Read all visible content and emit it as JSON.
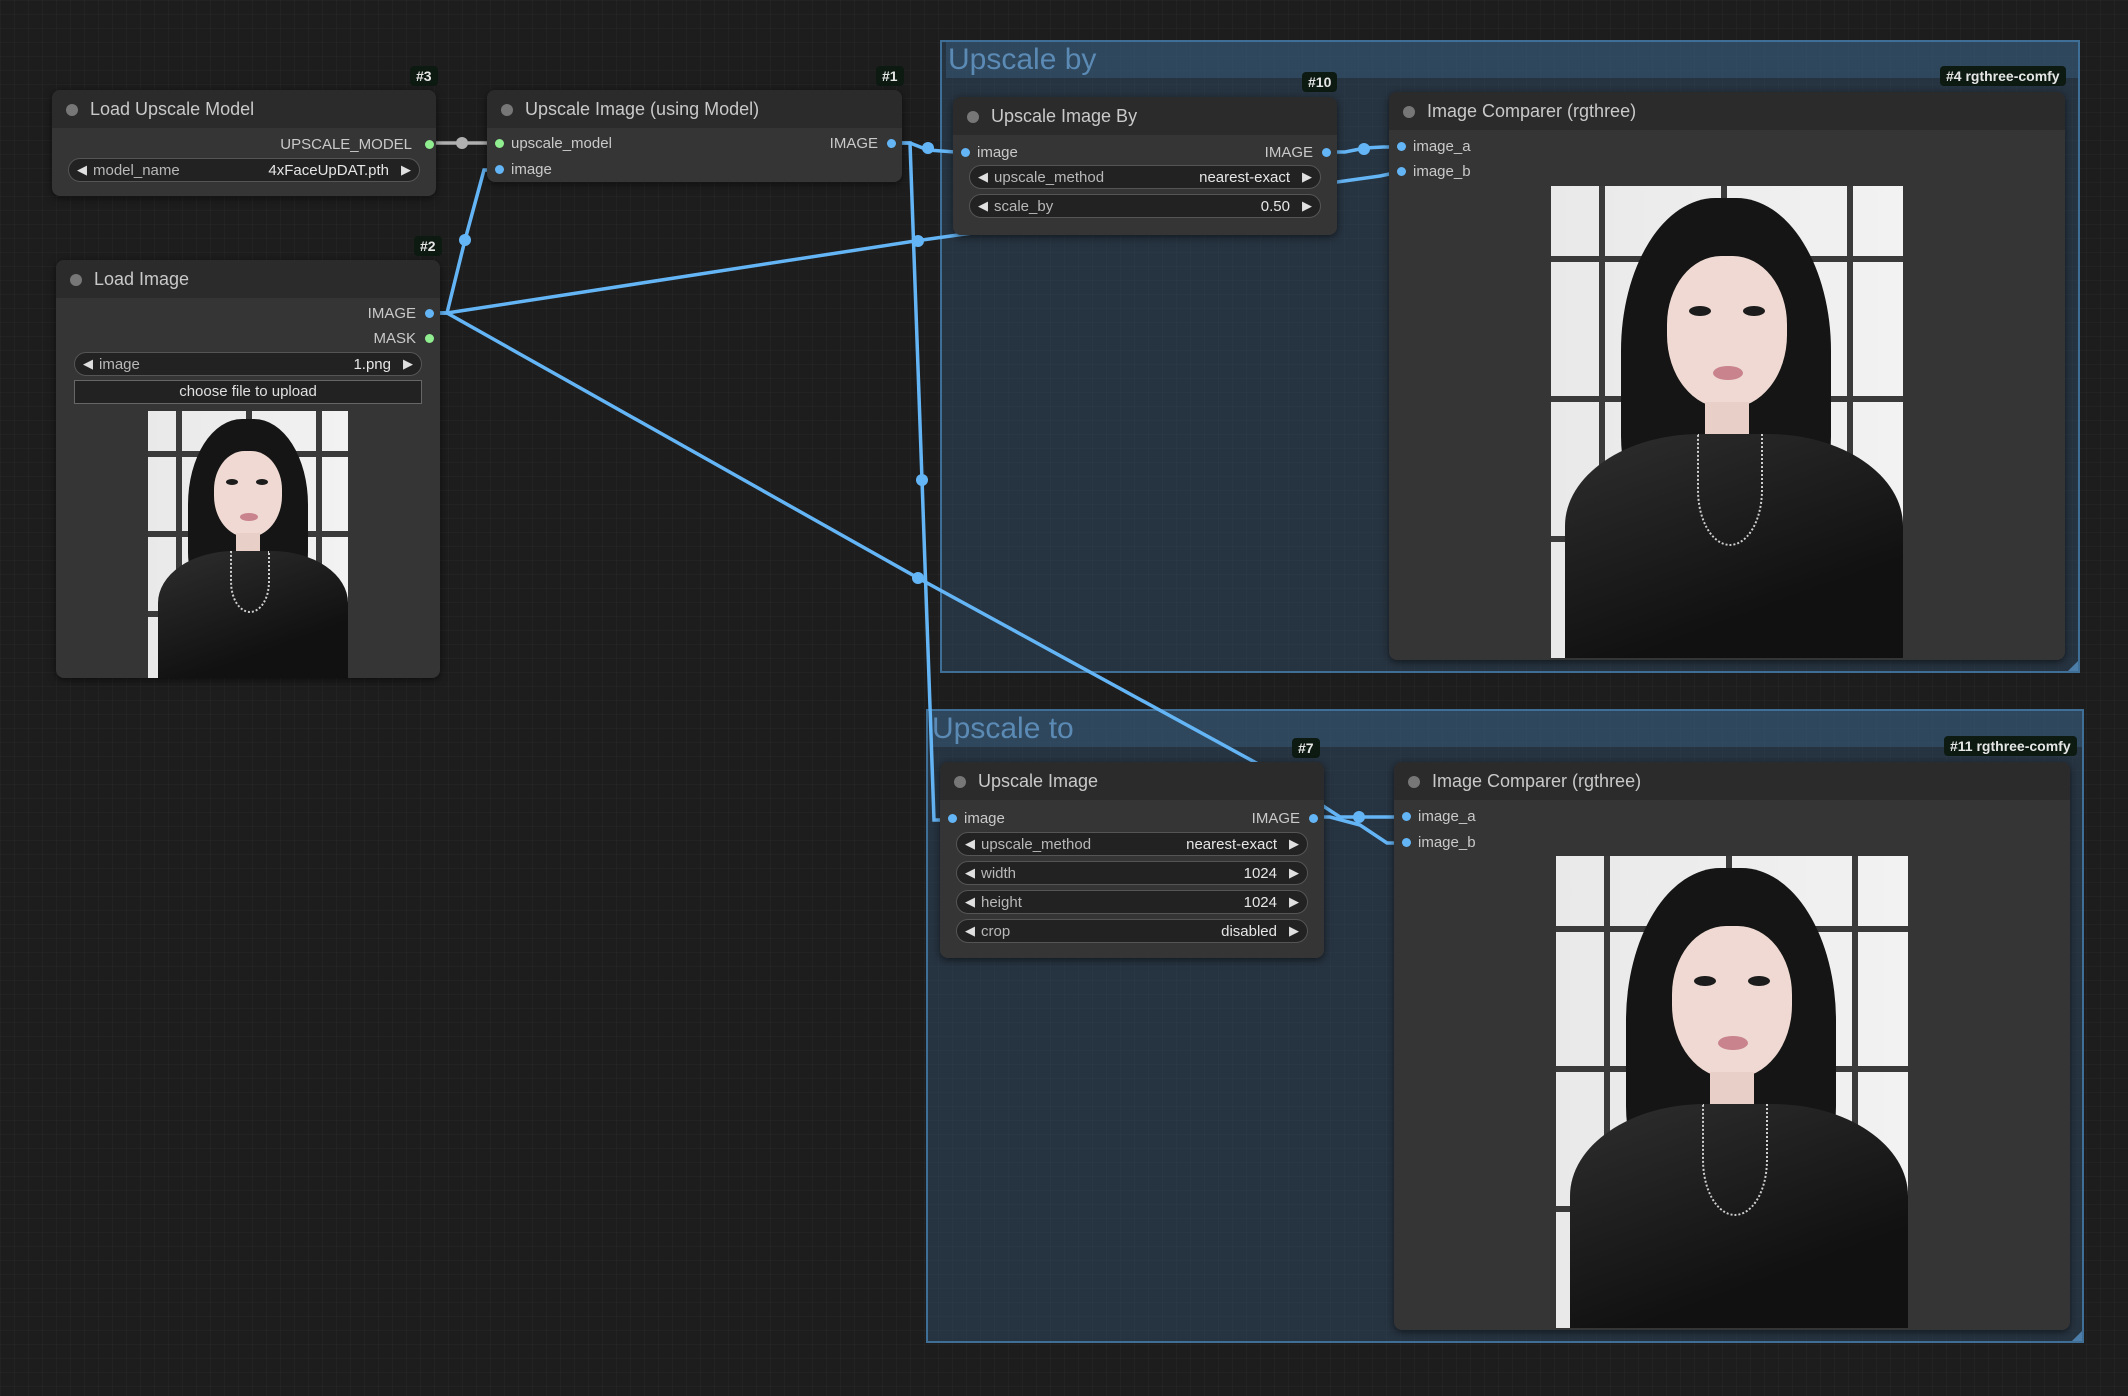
{
  "groups": {
    "upscale_by": {
      "title": "Upscale by"
    },
    "upscale_to": {
      "title": "Upscale to"
    }
  },
  "nodes": {
    "load_upscale_model": {
      "id": "#3",
      "title": "Load Upscale Model",
      "outputs": [
        "UPSCALE_MODEL"
      ],
      "widgets": [
        {
          "name": "model_name",
          "value": "4xFaceUpDAT.pth"
        }
      ]
    },
    "upscale_image_model": {
      "id": "#1",
      "title": "Upscale Image (using Model)",
      "inputs": [
        "upscale_model",
        "image"
      ],
      "outputs": [
        "IMAGE"
      ]
    },
    "load_image": {
      "id": "#2",
      "title": "Load Image",
      "outputs": [
        "IMAGE",
        "MASK"
      ],
      "widgets": [
        {
          "name": "image",
          "value": "1.png"
        }
      ],
      "upload_label": "choose file to upload"
    },
    "upscale_image_by": {
      "id": "#10",
      "title": "Upscale Image By",
      "inputs": [
        "image"
      ],
      "outputs": [
        "IMAGE"
      ],
      "widgets": [
        {
          "name": "upscale_method",
          "value": "nearest-exact"
        },
        {
          "name": "scale_by",
          "value": "0.50"
        }
      ]
    },
    "image_comparer_4": {
      "id": "#4 rgthree-comfy",
      "title": "Image Comparer (rgthree)",
      "inputs": [
        "image_a",
        "image_b"
      ]
    },
    "upscale_image": {
      "id": "#7",
      "title": "Upscale Image",
      "inputs": [
        "image"
      ],
      "outputs": [
        "IMAGE"
      ],
      "widgets": [
        {
          "name": "upscale_method",
          "value": "nearest-exact"
        },
        {
          "name": "width",
          "value": "1024"
        },
        {
          "name": "height",
          "value": "1024"
        },
        {
          "name": "crop",
          "value": "disabled"
        }
      ]
    },
    "image_comparer_11": {
      "id": "#11 rgthree-comfy",
      "title": "Image Comparer (rgthree)",
      "inputs": [
        "image_a",
        "image_b"
      ]
    }
  },
  "icons": {
    "left_arrow": "◀",
    "right_arrow": "▶"
  },
  "colors": {
    "image_link": "#64b5f6",
    "model_link": "#b0b0b0",
    "group_fill": "#345778",
    "node_bg": "#353535"
  }
}
